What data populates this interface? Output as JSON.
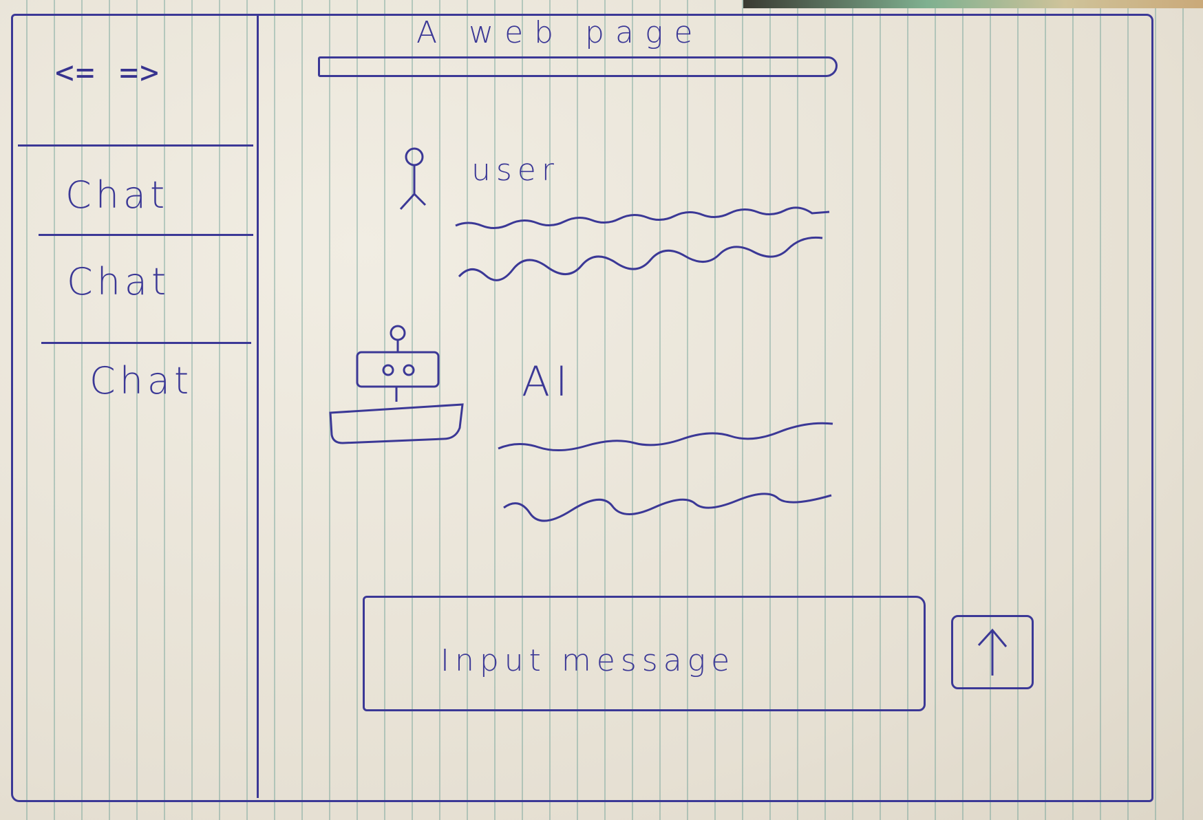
{
  "window": {
    "title": "A web page"
  },
  "nav": {
    "back_label": "<=",
    "forward_label": "=>"
  },
  "sidebar": {
    "items": [
      {
        "label": "Chat"
      },
      {
        "label": "Chat"
      },
      {
        "label": "Chat"
      }
    ]
  },
  "conversation": {
    "messages": [
      {
        "role": "user",
        "role_label": "user",
        "avatar_icon": "user-stick-figure-icon"
      },
      {
        "role": "ai",
        "role_label": "AI",
        "avatar_icon": "robot-icon"
      }
    ]
  },
  "composer": {
    "placeholder": "Input message",
    "send_icon": "arrow-up-icon"
  },
  "colors": {
    "ink": "#3b3896",
    "paper": "#ebe6da",
    "rule": "#6ea096"
  }
}
